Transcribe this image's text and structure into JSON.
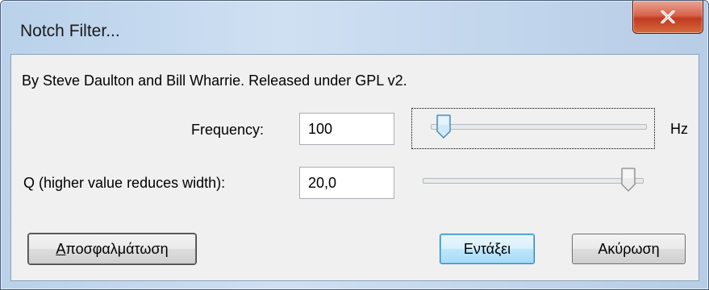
{
  "window": {
    "title": "Notch Filter...",
    "close_icon": "close-icon"
  },
  "dialog": {
    "byline": "By Steve Daulton and Bill Wharrie. Released under GPL v2."
  },
  "frequency": {
    "label": "Frequency:",
    "value": "100",
    "unit": "Hz",
    "slider_level": 0.03
  },
  "q": {
    "label": "Q (higher value reduces width):",
    "value": "20,0",
    "slider_level": 0.97
  },
  "buttons": {
    "debug_first": "Α",
    "debug_rest": "ποσφαλμάτωση",
    "ok": "Εντάξει",
    "cancel": "Ακύρωση"
  },
  "colors": {
    "close_button": "#c23a21",
    "default_button_border": "#3c7fb1",
    "dialog_background": "#f0f0f0"
  }
}
